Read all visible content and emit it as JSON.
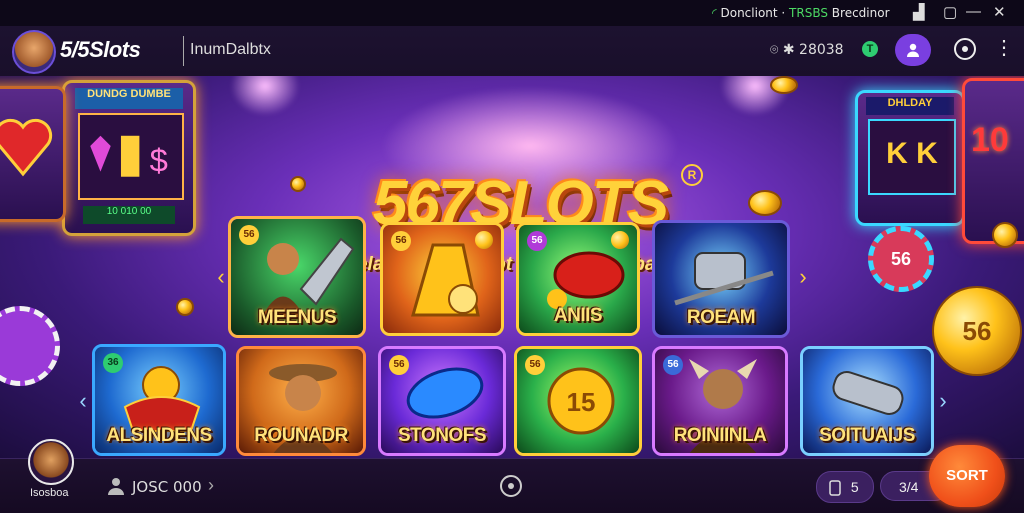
{
  "status_bar": {
    "text_prefix": "Doncliont · ",
    "text_signal": "TRSBS",
    "text_suffix": " Brecdinor"
  },
  "window_controls": {
    "minimize": "—",
    "restore": "▢",
    "close": "✕",
    "signal": "▟"
  },
  "header": {
    "logo_text": "5/5Slots",
    "nav_title": "InumDalbtx",
    "balance": "⌾ ✱ 28038",
    "coin_badge": "T",
    "profile_icon": "person-icon",
    "more_icon": "⋮"
  },
  "hero": {
    "brand": "567SLOTS",
    "brand_mark": "R",
    "tagline": "Jelajori Dunia Slot yang Tak Terbatis",
    "left_machine_sign": "DUNDG DUMBE",
    "left_machine_counter": "10 010 00",
    "right_machine_sign": "DHLDAY",
    "right_machine_reels": "K K",
    "right_machine_counter": "10"
  },
  "games_row1": [
    {
      "label": "MEENUS",
      "badge": "56",
      "accent": "#2a8a4a"
    },
    {
      "label": "",
      "badge": "56",
      "accent": "#d8640f"
    },
    {
      "label": "ANIIS",
      "badge": "56",
      "accent": "#2aa84a"
    },
    {
      "label": "ROEAM",
      "badge": "",
      "accent": "#1d3a9a"
    }
  ],
  "games_row2": [
    {
      "label": "ALSINDENS",
      "badge": "36",
      "accent": "#1e6ad0"
    },
    {
      "label": "ROUNADR",
      "badge": "",
      "accent": "#d06a1a"
    },
    {
      "label": "STONOFS",
      "badge": "56",
      "accent": "#6a2ad8"
    },
    {
      "label": "",
      "badge": "56",
      "accent": "#2ab04a"
    },
    {
      "label": "ROINIINLA",
      "badge": "56",
      "accent": "#6a1a8a"
    },
    {
      "label": "SOITUAIJS",
      "badge": "",
      "accent": "#2a6ad8"
    }
  ],
  "coin_labels": {
    "chip_right": "56",
    "big_coin": "56",
    "mid_coin": "15"
  },
  "bottom_bar": {
    "user_name": "Isosboa",
    "credits": "JOSC 000",
    "chevron": "›",
    "count_pill": "5",
    "ratio_pill": "3/4",
    "sort_button": "SORT"
  }
}
